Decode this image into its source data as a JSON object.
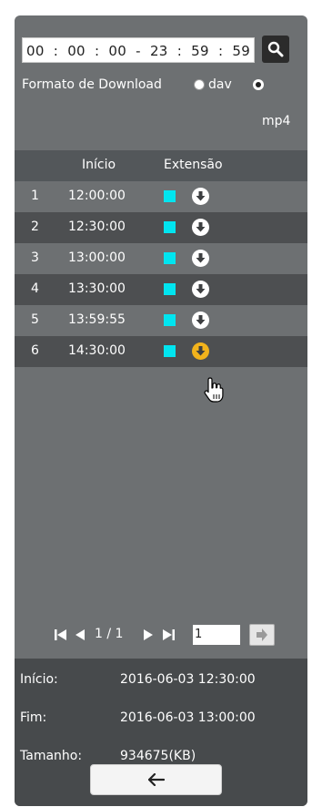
{
  "search": {
    "time_range": [
      "00",
      ":",
      "00",
      ":",
      "00",
      "-",
      "23",
      ":",
      "59",
      ":",
      "59"
    ]
  },
  "download_format": {
    "label": "Formato de Download",
    "options": [
      "dav",
      "mp4"
    ],
    "selected": "mp4"
  },
  "list": {
    "col_start": "Início",
    "col_ext": "Extensão",
    "rows": [
      {
        "num": "1",
        "time": "12:00:00"
      },
      {
        "num": "2",
        "time": "12:30:00"
      },
      {
        "num": "3",
        "time": "13:00:00"
      },
      {
        "num": "4",
        "time": "13:30:00"
      },
      {
        "num": "5",
        "time": "13:59:55"
      },
      {
        "num": "6",
        "time": "14:30:00"
      }
    ]
  },
  "pager": {
    "text": "1 / 1",
    "page_input": "1"
  },
  "info": {
    "start_label": "Início:",
    "start_value": "2016-06-03 12:30:00",
    "end_label": "Fim:",
    "end_value": "2016-06-03 13:00:00",
    "size_label": "Tamanho:",
    "size_value": "934675(KB)"
  },
  "colors": {
    "panel": "#6d7072",
    "row_dark": "#4d4f51",
    "square": "#00e5f0",
    "download_active": "#f2b31c"
  }
}
